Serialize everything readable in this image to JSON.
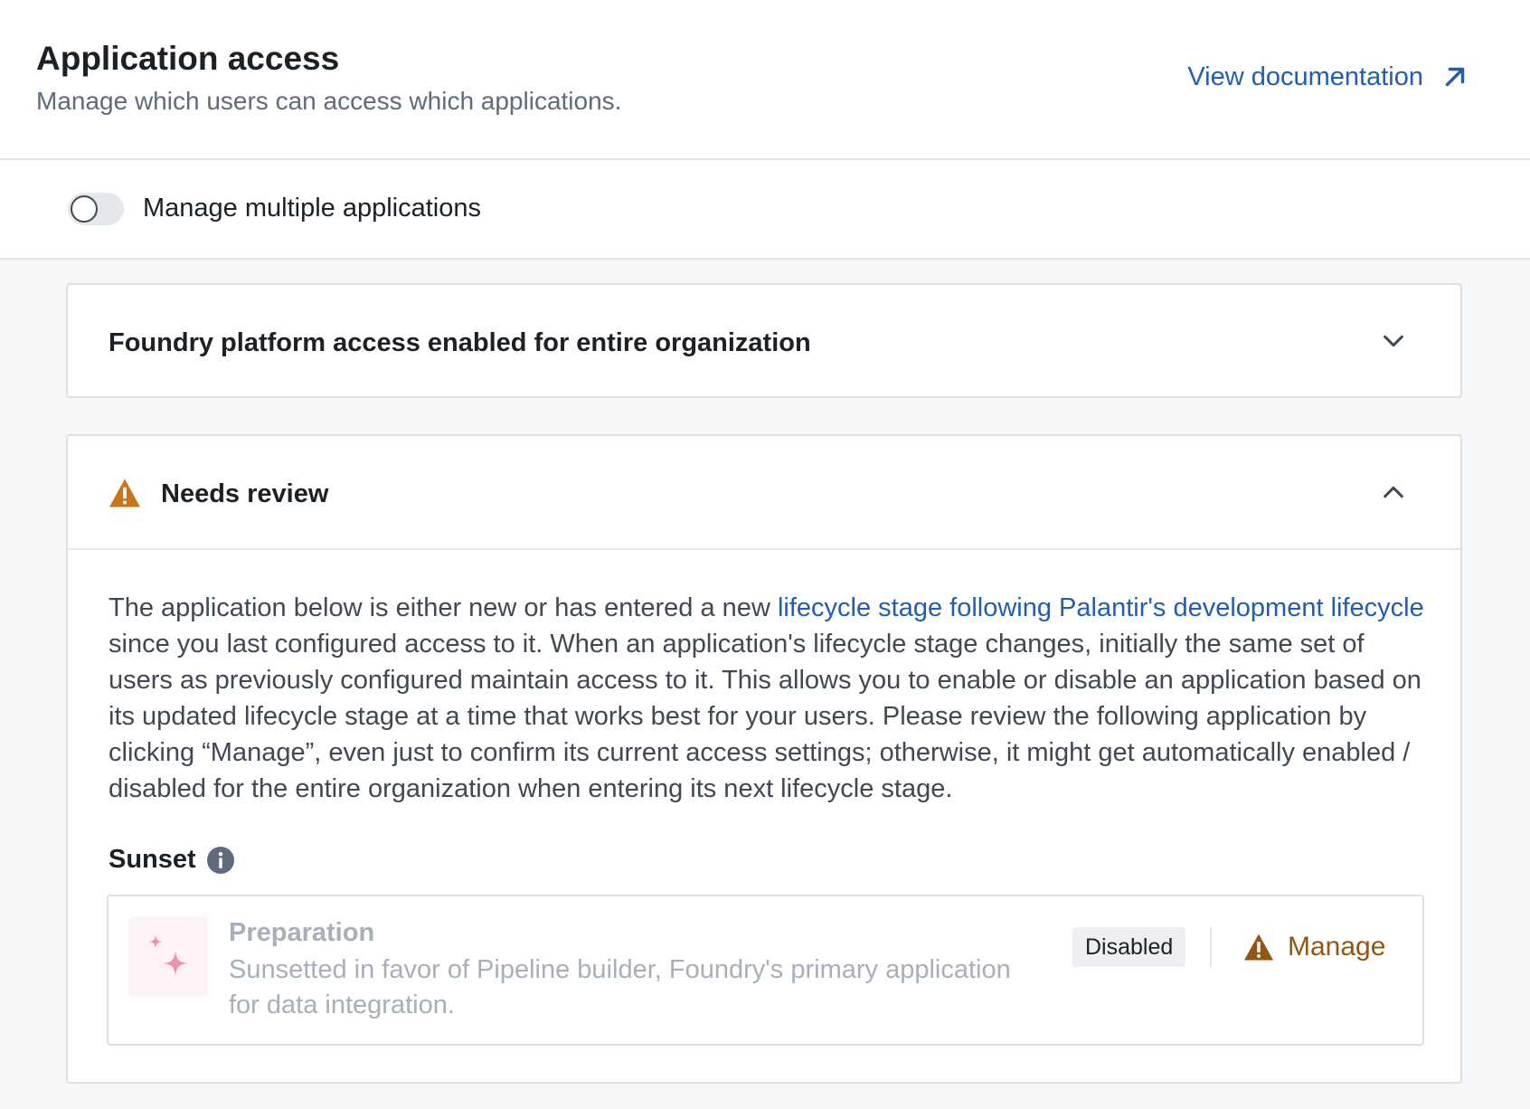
{
  "header": {
    "title": "Application access",
    "subtitle": "Manage which users can access which applications.",
    "doc_link": "View documentation"
  },
  "toggle": {
    "label": "Manage multiple applications",
    "checked": false
  },
  "platform_card": {
    "title": "Foundry platform access enabled for entire organization",
    "expanded": false
  },
  "review_card": {
    "title": "Needs review",
    "expanded": true,
    "description": {
      "text_before": "The application below is either new or has entered a new ",
      "link_text": "lifecycle stage following Palantir's development lifecycle",
      "text_after": " since you last configured access to it. When an application's lifecycle stage changes, initially the same set of users as previously configured maintain access to it. This allows you to enable or disable an application based on its updated lifecycle stage at a time that works best for your users. Please review the following application by clicking “Manage”, even just to confirm its current access settings; otherwise, it might get automatically enabled / disabled for the entire organization when entering its next lifecycle stage."
    },
    "section_label": "Sunset",
    "app": {
      "name": "Preparation",
      "description": "Sunsetted in favor of Pipeline builder, Foundry's primary application for data integration.",
      "status": "Disabled",
      "action": "Manage"
    }
  },
  "colors": {
    "link": "#215db0",
    "warning": "#c87619",
    "warning_text": "#935610",
    "logo_sparkle": "#f08fb2"
  },
  "icons": [
    "external-link-icon",
    "chevron-down-icon",
    "chevron-up-icon",
    "warning-icon",
    "info-icon",
    "sparkle-icon"
  ]
}
